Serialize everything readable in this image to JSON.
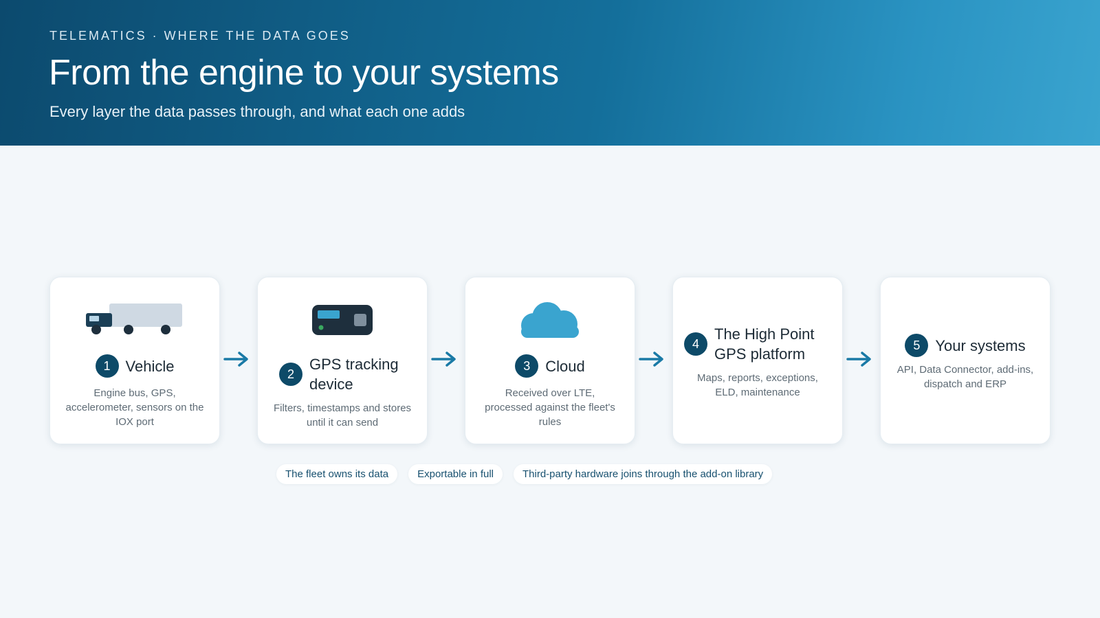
{
  "header": {
    "eyebrow": "TELEMATICS · WHERE THE DATA GOES",
    "title": "From the engine to your systems",
    "subtitle": "Every layer the data passes through, and what each one adds"
  },
  "steps": [
    {
      "number": "1",
      "title": "Vehicle",
      "description": "Engine bus, GPS, accelerometer, sensors on the IOX port",
      "icon": "truck-icon"
    },
    {
      "number": "2",
      "title": "GPS tracking device",
      "description": "Filters, timestamps and stores until it can send",
      "icon": "gps-device-icon"
    },
    {
      "number": "3",
      "title": "Cloud",
      "description": "Received over LTE, processed against the fleet's rules",
      "icon": "cloud-icon"
    },
    {
      "number": "4",
      "title": "The High Point GPS platform",
      "description": "Maps, reports, exceptions, ELD, maintenance",
      "icon": ""
    },
    {
      "number": "5",
      "title": "Your systems",
      "description": "API, Data Connector, add-ins, dispatch and ERP",
      "icon": ""
    }
  ],
  "chips": [
    "The fleet owns its data",
    "Exportable in full",
    "Third-party hardware joins through the add-on library"
  ],
  "colors": {
    "header_dark": "#0c4a6e",
    "header_light": "#3aa4cf",
    "number_badge": "#0d4a68",
    "arrow": "#1a7aa6",
    "cloud": "#3aa4cf",
    "device_body": "#1e2f3d"
  }
}
